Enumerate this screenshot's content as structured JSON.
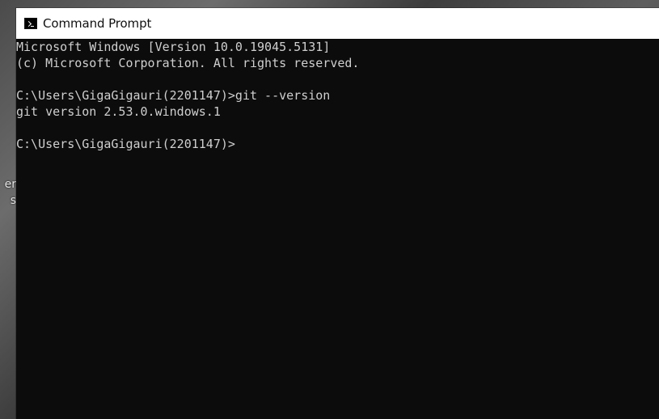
{
  "desktop": {
    "partial_text_lines": [
      "er",
      "s"
    ]
  },
  "window": {
    "title": "Command Prompt",
    "icon": "cmd-icon"
  },
  "console": {
    "lines": [
      "Microsoft Windows [Version 10.0.19045.5131]",
      "(c) Microsoft Corporation. All rights reserved.",
      "",
      "C:\\Users\\GigaGigauri(2201147)>git --version",
      "git version 2.53.0.windows.1",
      "",
      "C:\\Users\\GigaGigauri(2201147)>"
    ]
  },
  "colors": {
    "console_background": "#0c0c0c",
    "console_text": "#cfcfcf",
    "titlebar_background": "#ffffff"
  }
}
